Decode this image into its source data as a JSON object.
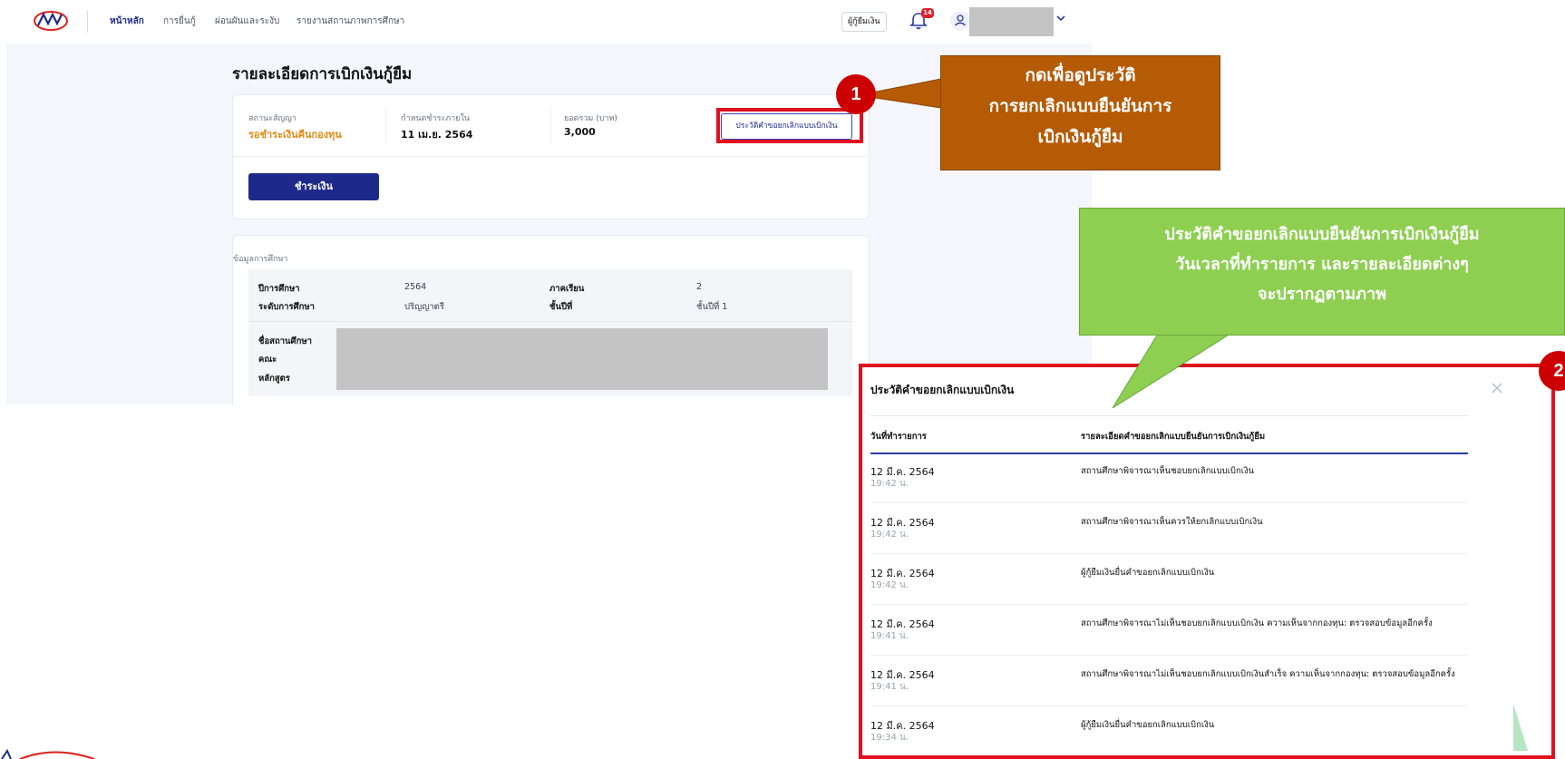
{
  "nav": {
    "items": [
      "หน้าหลัก",
      "การยื่นกู้",
      "ผ่อนผันและระงับ",
      "รายงานสถานภาพการศึกษา"
    ],
    "role_badge": "ผู้กู้ยืมเงิน",
    "notification_count": "14"
  },
  "page": {
    "title": "รายละเอียดการเบิกเงินกู้ยืม",
    "summary": {
      "status_label": "สถานะสัญญา",
      "status_value": "รอชำระเงินคืนกองทุน",
      "due_label": "กำหนดชำระภายใน",
      "due_value": "11 เม.ย. 2564",
      "total_label": "ยอดรวม (บาท)",
      "total_value": "3,000",
      "history_button": "ประวัติคำขอยกเลิกแบบเบิกเงิน",
      "pay_button": "ชำระเงิน"
    },
    "education": {
      "section_title": "ข้อมูลการศึกษา",
      "year_label": "ปีการศึกษา",
      "year_value": "2564",
      "semester_label": "ภาคเรียน",
      "semester_value": "2",
      "level_label": "ระดับการศึกษา",
      "level_value": "ปริญญาตรี",
      "grade_label": "ชั้นปีที่",
      "grade_value": "ชั้นปีที่ 1",
      "institution_label": "ชื่อสถานศึกษา",
      "faculty_label": "คณะ",
      "program_label": "หลักสูตร"
    }
  },
  "callouts": {
    "one": {
      "number": "1",
      "lines": [
        "กดเพื่อดูประวัติ",
        "การยกเลิกแบบยืนยันการ",
        "เบิกเงินกู้ยืม"
      ]
    },
    "two": {
      "number": "2",
      "lines": [
        "ประวัติคำขอยกเลิกแบบยืนยันการเบิกเงินกู้ยืม",
        "วันเวลาที่ทำรายการ และรายละเอียดต่างๆ",
        "จะปรากฏตามภาพ"
      ]
    }
  },
  "modal": {
    "title": "ประวัติคำขอยกเลิกแบบเบิกเงิน",
    "col_date": "วันที่ทำรายการ",
    "col_detail": "รายละเอียดคำขอยกเลิกแบบยืนยันการเบิกเงินกู้ยืม",
    "rows": [
      {
        "date": "12 มี.ค. 2564",
        "time": "19:42 น.",
        "detail": "สถานศึกษาพิจารณาเห็นชอบยกเลิกแบบเบิกเงิน"
      },
      {
        "date": "12 มี.ค. 2564",
        "time": "19:42 น.",
        "detail": "สถานศึกษาพิจารณาเห็นควรให้ยกเลิกแบบเบิกเงิน"
      },
      {
        "date": "12 มี.ค. 2564",
        "time": "19:42 น.",
        "detail": "ผู้กู้ยืมเงินยื่นคำขอยกเลิกแบบเบิกเงิน"
      },
      {
        "date": "12 มี.ค. 2564",
        "time": "19:41 น.",
        "detail": "สถานศึกษาพิจารณาไม่เห็นชอบยกเลิกแบบเบิกเงิน ความเห็นจากกองทุน: ตรวจสอบข้อมูลอีกครั้ง"
      },
      {
        "date": "12 มี.ค. 2564",
        "time": "19:41 น.",
        "detail": "สถานศึกษาพิจารณาไม่เห็นชอบยกเลิกแบบเบิกเงินสำเร็จ ความเห็นจากกองทุน: ตรวจสอบข้อมูลอีกครั้ง"
      },
      {
        "date": "12 มี.ค. 2564",
        "time": "19:34 น.",
        "detail": "ผู้กู้ยืมเงินยื่นคำขอยกเลิกแบบเบิกเงิน"
      }
    ]
  },
  "colors": {
    "brand_navy": "#1e2a8a",
    "status_orange": "#e08a16",
    "callout_brown": "#b55a05",
    "callout_green": "#8ecf52",
    "highlight_red": "#e0101e"
  }
}
